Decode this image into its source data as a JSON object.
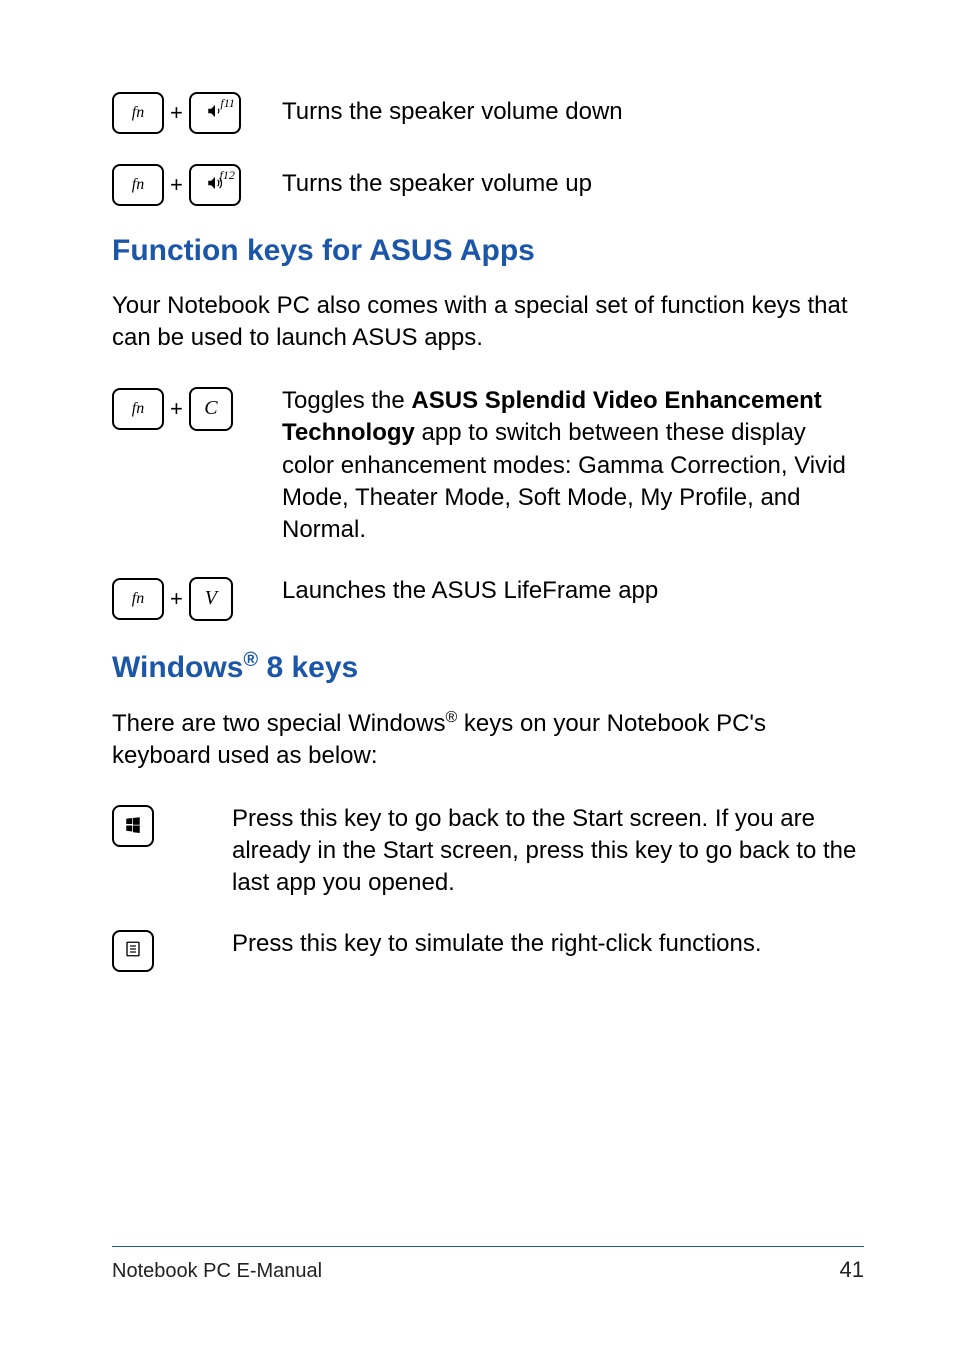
{
  "shortcuts_top": [
    {
      "key1": "fn",
      "key2_sup": "f11",
      "key2_icon": "speaker-down",
      "desc": "Turns the speaker volume down"
    },
    {
      "key1": "fn",
      "key2_sup": "f12",
      "key2_icon": "speaker-up",
      "desc": "Turns the speaker volume up"
    }
  ],
  "section_asus": {
    "heading": "Function keys for ASUS Apps",
    "intro": "Your Notebook PC also comes with a special set of function keys that can be used to launch ASUS apps.",
    "rows": [
      {
        "key1": "fn",
        "key2": "C",
        "desc_pre": "Toggles the ",
        "desc_bold": "ASUS Splendid Video Enhancement Technology",
        "desc_post": " app to switch between these display color enhancement modes: Gamma Correction, Vivid Mode, Theater Mode, Soft Mode, My Profile, and Normal."
      },
      {
        "key1": "fn",
        "key2": "V",
        "desc": "Launches the ASUS LifeFrame app"
      }
    ]
  },
  "section_windows": {
    "heading_pre": "Windows",
    "heading_reg": "®",
    "heading_post": " 8 keys",
    "intro_pre": "There are two special Windows",
    "intro_reg": "®",
    "intro_post": " keys on your Notebook PC's keyboard used as below:",
    "rows": [
      {
        "icon": "windows",
        "desc": "Press this key to go back to the Start screen. If you are already in the Start screen, press this key to go back to the last app you opened."
      },
      {
        "icon": "menu",
        "desc": "Press this key to simulate the right-click functions."
      }
    ]
  },
  "footer": {
    "title": "Notebook PC E-Manual",
    "page": "41"
  }
}
